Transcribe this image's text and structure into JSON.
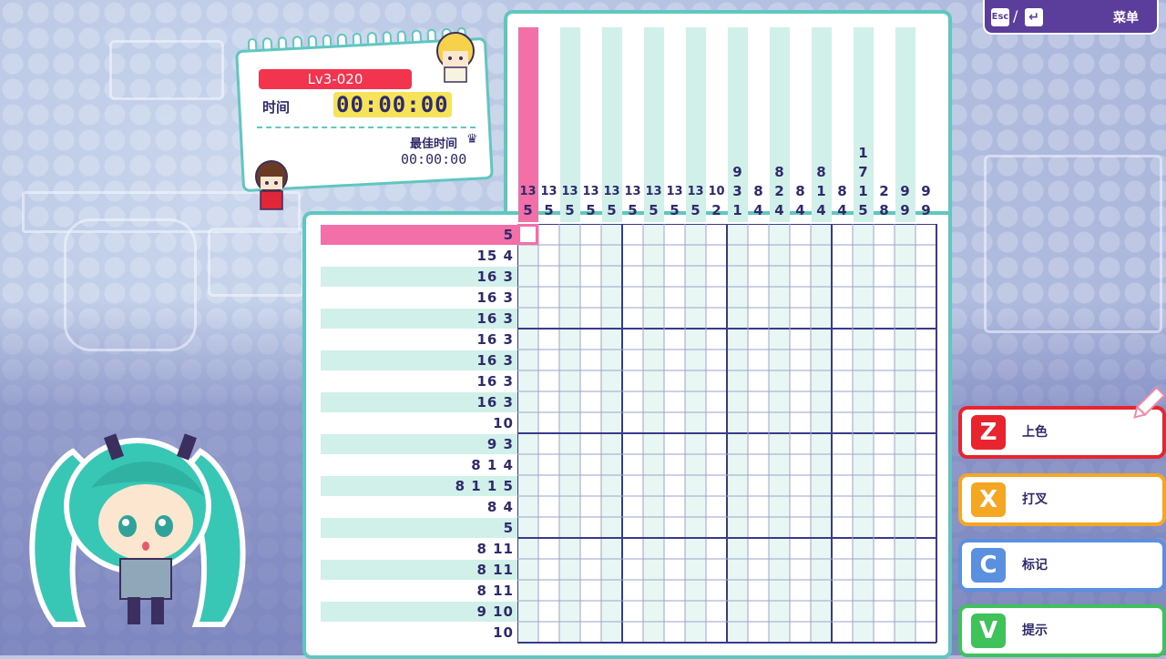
{
  "menu": {
    "esc_key": "Esc",
    "enter_key": "↵",
    "slash": "/",
    "label": "菜单"
  },
  "info": {
    "level": "Lv3-020",
    "time_label": "时间",
    "time_value": "00:00:00",
    "best_time_label": "最佳时间",
    "best_time_value": "00:00:00",
    "crown_icon": "crown-icon"
  },
  "tools": [
    {
      "key": "Z",
      "label": "上色",
      "color": "#e8242f",
      "selected": true
    },
    {
      "key": "X",
      "label": "打叉",
      "color": "#f5a623"
    },
    {
      "key": "C",
      "label": "标记",
      "color": "#5b8fe0"
    },
    {
      "key": "V",
      "label": "提示",
      "color": "#3fc25a"
    }
  ],
  "puzzle": {
    "columns": 20,
    "rows": 20,
    "selected_column": 1,
    "selected_row": 1,
    "column_clues": [
      [
        "13",
        "5"
      ],
      [
        "13",
        "5"
      ],
      [
        "13",
        "5"
      ],
      [
        "13",
        "5"
      ],
      [
        "13",
        "5"
      ],
      [
        "13",
        "5"
      ],
      [
        "13",
        "5"
      ],
      [
        "13",
        "5"
      ],
      [
        "13",
        "5"
      ],
      [
        "10",
        "2"
      ],
      [
        "9",
        "3",
        "1"
      ],
      [
        "8",
        "4"
      ],
      [
        "8",
        "2",
        "4"
      ],
      [
        "8",
        "4"
      ],
      [
        "8",
        "1",
        "4"
      ],
      [
        "8",
        "4"
      ],
      [
        "1",
        "7",
        "1",
        "5"
      ],
      [
        "2",
        "8"
      ],
      [
        "9",
        "9"
      ],
      [
        "9",
        "9"
      ]
    ],
    "row_clues": [
      "5",
      "15 4",
      "16 3",
      "16 3",
      "16 3",
      "16 3",
      "16 3",
      "16 3",
      "16 3",
      "10",
      "9 3",
      "8 1 4",
      "8 1 1 5",
      "8 4",
      "5",
      "8 11",
      "8 11",
      "8 11",
      "9 10",
      "10"
    ]
  },
  "colors": {
    "board_border": "#5fc7bf",
    "clue_stripe": "#d2f0ea",
    "selection_pink": "#f26fa8",
    "clue_text": "#2e2a6b",
    "menu_bg": "#5b3e9b"
  }
}
